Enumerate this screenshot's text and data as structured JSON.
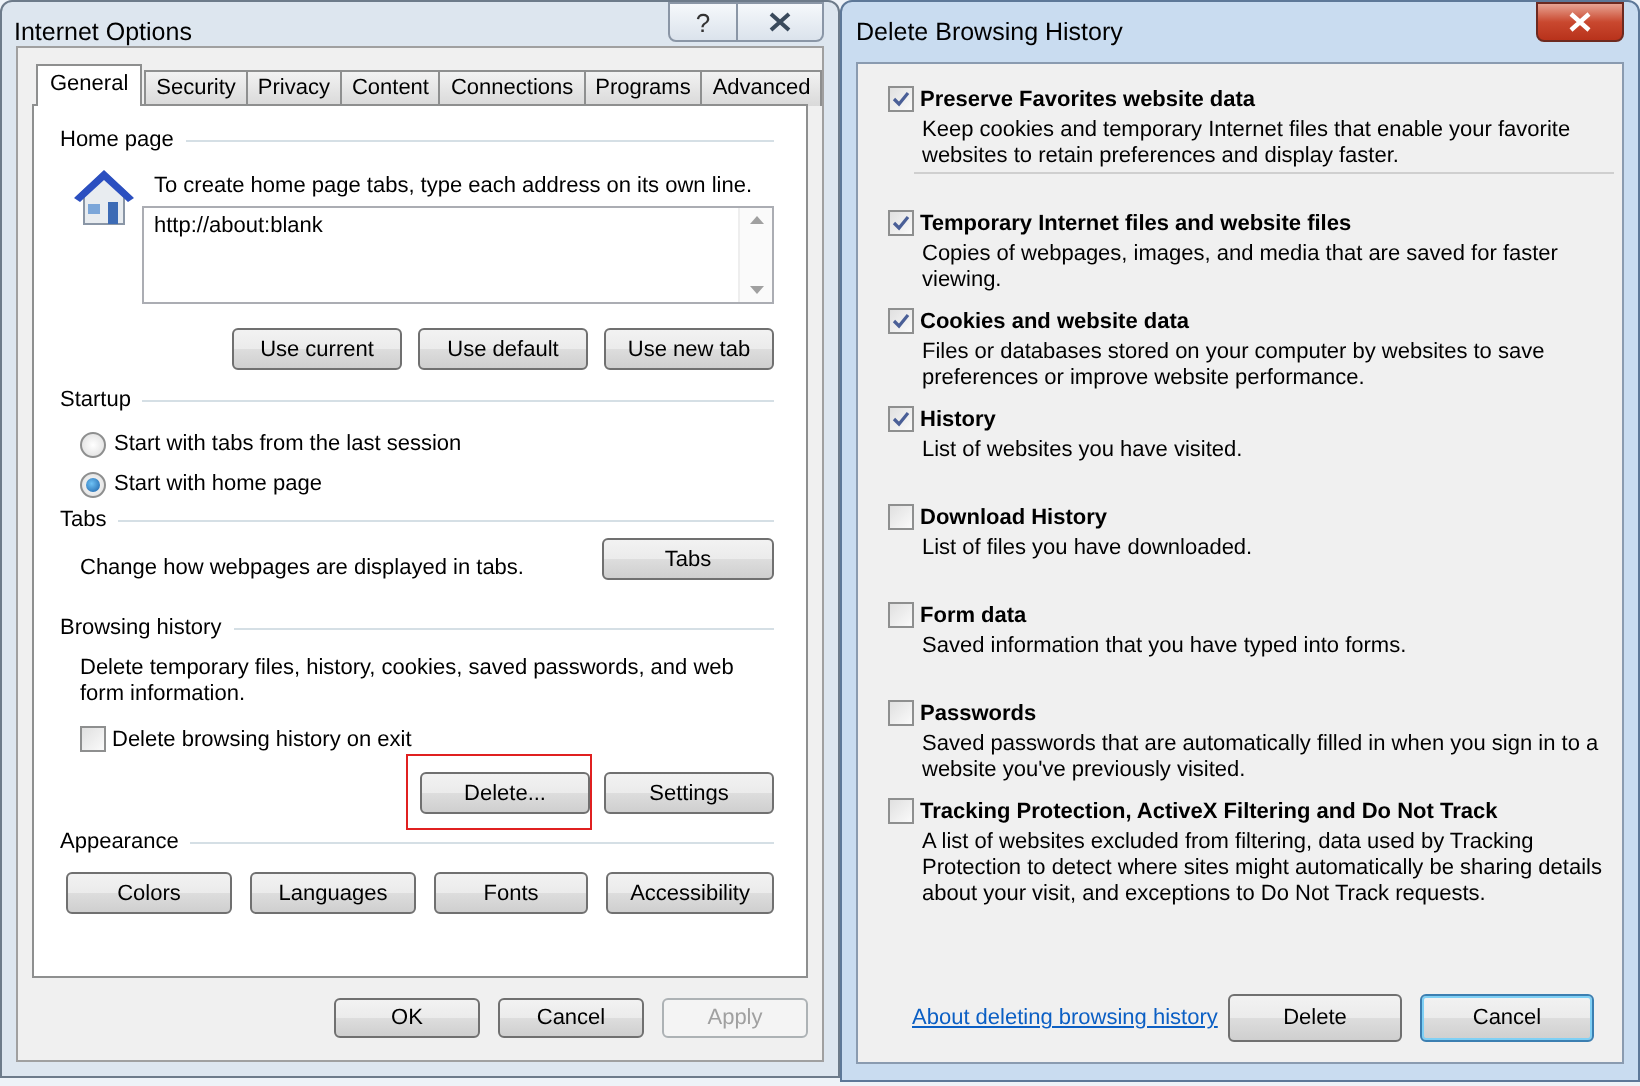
{
  "internet_options": {
    "title": "Internet Options",
    "help": "?",
    "tabs": [
      {
        "label": "General",
        "selected": true
      },
      {
        "label": "Security",
        "selected": false
      },
      {
        "label": "Privacy",
        "selected": false
      },
      {
        "label": "Content",
        "selected": false
      },
      {
        "label": "Connections",
        "selected": false
      },
      {
        "label": "Programs",
        "selected": false
      },
      {
        "label": "Advanced",
        "selected": false
      }
    ],
    "home_page": {
      "heading": "Home page",
      "instruction": "To create home page tabs, type each address on its own line.",
      "addresses": "http://about:blank",
      "buttons": [
        "Use current",
        "Use default",
        "Use new tab"
      ]
    },
    "startup": {
      "heading": "Startup",
      "options": [
        {
          "label": "Start with tabs from the last session",
          "selected": false
        },
        {
          "label": "Start with home page",
          "selected": true
        }
      ]
    },
    "tabs_section": {
      "heading": "Tabs",
      "text": "Change how webpages are displayed in tabs.",
      "button": "Tabs"
    },
    "browsing_history": {
      "heading": "Browsing history",
      "text": "Delete temporary files, history, cookies, saved passwords, and web form information.",
      "checkbox": {
        "label": "Delete browsing history on exit",
        "checked": false
      },
      "buttons": [
        {
          "label": "Delete...",
          "highlighted": true
        },
        {
          "label": "Settings",
          "highlighted": false
        }
      ]
    },
    "appearance": {
      "heading": "Appearance",
      "buttons": [
        "Colors",
        "Languages",
        "Fonts",
        "Accessibility"
      ]
    },
    "footer_buttons": [
      {
        "label": "OK",
        "disabled": false
      },
      {
        "label": "Cancel",
        "disabled": false
      },
      {
        "label": "Apply",
        "disabled": true
      }
    ]
  },
  "delete_browsing_history": {
    "title": "Delete Browsing History",
    "items": [
      {
        "label": "Preserve Favorites website data",
        "description": "Keep cookies and temporary Internet files that enable your favorite websites to retain preferences and display faster.",
        "checked": true,
        "divider_after": true
      },
      {
        "label": "Temporary Internet files and website files",
        "description": "Copies of webpages, images, and media that are saved for faster viewing.",
        "checked": true,
        "divider_after": false
      },
      {
        "label": "Cookies and website data",
        "description": "Files or databases stored on your computer by websites to save preferences or improve website performance.",
        "checked": true,
        "divider_after": false
      },
      {
        "label": "History",
        "description": "List of websites you have visited.",
        "checked": true,
        "divider_after": false
      },
      {
        "label": "Download History",
        "description": "List of files you have downloaded.",
        "checked": false,
        "divider_after": false
      },
      {
        "label": "Form data",
        "description": "Saved information that you have typed into forms.",
        "checked": false,
        "divider_after": false
      },
      {
        "label": "Passwords",
        "description": "Saved passwords that are automatically filled in when you sign in to a website you've previously visited.",
        "checked": false,
        "divider_after": false
      },
      {
        "label": "Tracking Protection, ActiveX Filtering and Do Not Track",
        "description": "A list of websites excluded from filtering, data used by Tracking Protection to detect where sites might automatically be sharing details about your visit, and exceptions to Do Not Track requests.",
        "checked": false,
        "divider_after": false
      }
    ],
    "link": "About deleting browsing history",
    "buttons": [
      {
        "label": "Delete",
        "default": false
      },
      {
        "label": "Cancel",
        "default": true
      }
    ]
  }
}
